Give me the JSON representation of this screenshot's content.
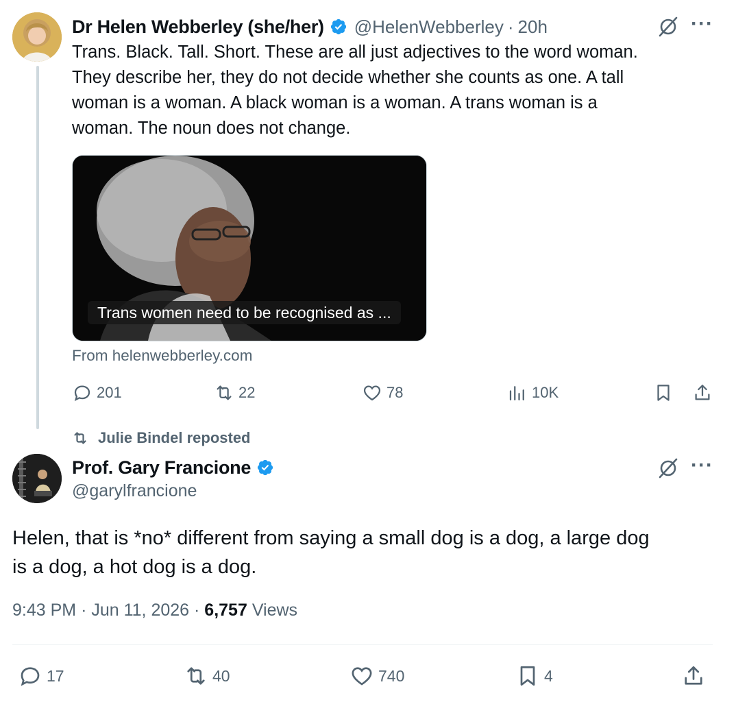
{
  "tweet1": {
    "author_name": "Dr Helen Webberley (she/her)",
    "handle": "@HelenWebberley",
    "separator": "·",
    "time": "20h",
    "text_lines": [
      "Trans. Black. Tall. Short. These are all just adjectives to the word woman.",
      "They describe her, they do not decide whether she counts as one. A tall",
      "woman is a woman. A black woman is a woman. A trans woman is a",
      "woman. The noun does not change."
    ],
    "media_caption": "Trans women need to be recognised as ...",
    "from_link": "From helenwebberley.com",
    "actions": {
      "replies": "201",
      "reposts": "22",
      "likes": "78",
      "views": "10K"
    }
  },
  "repost_note": "Julie Bindel reposted",
  "tweet2": {
    "author_name": "Prof. Gary Francione",
    "handle": "@garylfrancione",
    "text_lines": [
      "Helen, that is *no* different from saying a small dog is a dog, a large dog",
      "is a dog, a hot dog is a dog."
    ],
    "time": "9:43 PM",
    "sep1": "·",
    "date": "Jun 11, 2026",
    "sep2": "·",
    "views_count": "6,757",
    "views_label": "Views",
    "actions": {
      "replies": "17",
      "reposts": "40",
      "likes": "740",
      "bookmarks": "4"
    }
  },
  "icons": {
    "verified": "verified-badge-icon",
    "grok": "grok-icon",
    "more": "more-icon",
    "reply": "reply-icon",
    "repost": "repost-icon",
    "like": "heart-icon",
    "views": "views-icon",
    "bookmark": "bookmark-icon",
    "share": "share-icon"
  },
  "colors": {
    "text": "#0f1419",
    "muted": "#536471",
    "verified": "#1d9bf0",
    "thread_line": "#cfd9de"
  }
}
